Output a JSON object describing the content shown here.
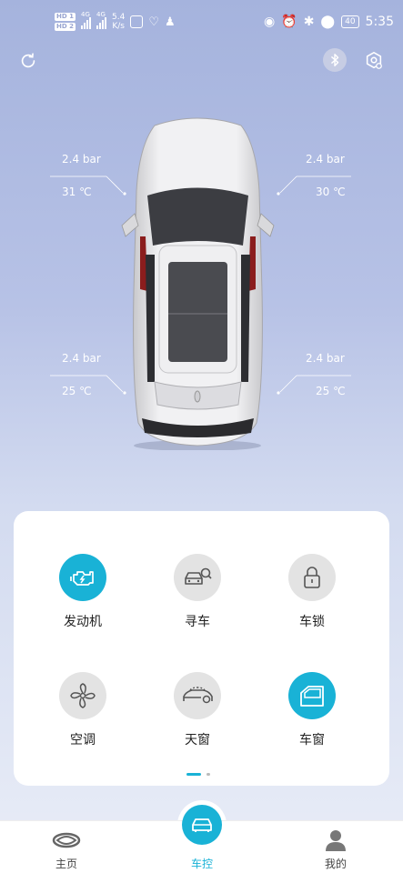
{
  "status_bar": {
    "sim1": "HD 1",
    "sim2": "HD 2",
    "net1": "4G",
    "net2": "4G",
    "speed_value": "5.4",
    "speed_unit": "K/s",
    "battery": "40",
    "time": "5:35"
  },
  "tires": {
    "front_left": {
      "pressure": "2.4 bar",
      "temp": "31 ℃"
    },
    "front_right": {
      "pressure": "2.4 bar",
      "temp": "30 ℃"
    },
    "rear_left": {
      "pressure": "2.4 bar",
      "temp": "25 ℃"
    },
    "rear_right": {
      "pressure": "2.4 bar",
      "temp": "25 ℃"
    }
  },
  "controls": [
    {
      "label": "发动机",
      "icon": "engine-icon",
      "active": true
    },
    {
      "label": "寻车",
      "icon": "find-car-icon",
      "active": false
    },
    {
      "label": "车锁",
      "icon": "lock-icon",
      "active": false
    },
    {
      "label": "空调",
      "icon": "fan-icon",
      "active": false
    },
    {
      "label": "天窗",
      "icon": "sunroof-icon",
      "active": false
    },
    {
      "label": "车窗",
      "icon": "window-icon",
      "active": true
    }
  ],
  "nav": {
    "home": "主页",
    "control": "车控",
    "mine": "我的"
  },
  "colors": {
    "accent": "#19b2d6",
    "inactive_icon_bg": "#e3e3e3"
  }
}
